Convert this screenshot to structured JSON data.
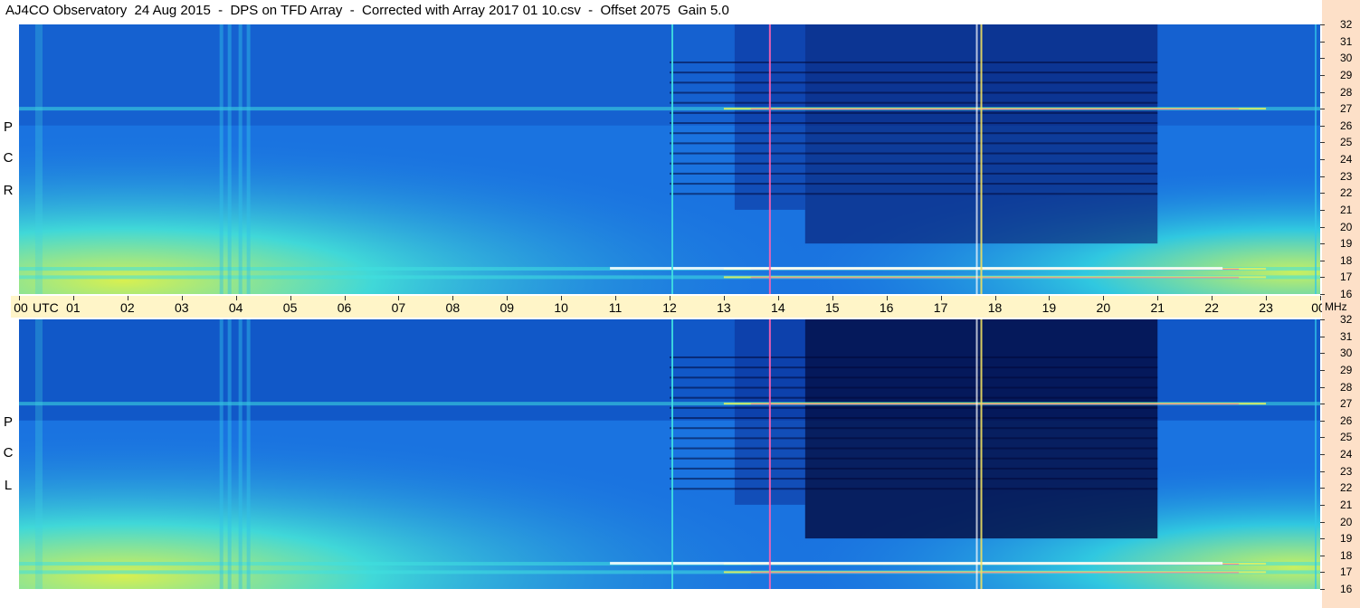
{
  "title": "AJ4CO Observatory  24 Aug 2015  -  DPS on TFD Array  -  Corrected with Array 2017 01 10.csv  -  Offset 2075  Gain 5.0",
  "panel_labels": {
    "top": [
      "R",
      "C",
      "P"
    ],
    "bottom": [
      "L",
      "C",
      "P"
    ]
  },
  "utc_axis_label": "UTC",
  "freq_unit": "MHz",
  "colors": {
    "background_blue": "#1a73e0",
    "dark_blue": "#081e7a",
    "cyan": "#2fd2e8",
    "yellow_green": "#c8f060",
    "utc_strip": "#fff5c8",
    "freq_column": "#fde0c8"
  },
  "chart_data": {
    "type": "heatmap",
    "title": "AJ4CO Observatory  24 Aug 2015  -  DPS on TFD Array  -  Corrected with Array 2017 01 10.csv  -  Offset 2075  Gain 5.0",
    "xlabel": "UTC",
    "ylabel": "MHz",
    "x_ticks": [
      "00",
      "01",
      "02",
      "03",
      "04",
      "05",
      "06",
      "07",
      "08",
      "09",
      "10",
      "11",
      "12",
      "13",
      "14",
      "15",
      "16",
      "17",
      "18",
      "19",
      "20",
      "21",
      "22",
      "23",
      "00"
    ],
    "xlim": [
      0,
      24
    ],
    "y_ticks": [
      "16",
      "17",
      "18",
      "19",
      "20",
      "21",
      "22",
      "23",
      "24",
      "25",
      "26",
      "27",
      "28",
      "29",
      "30",
      "31",
      "32"
    ],
    "ylim": [
      16,
      32
    ],
    "panels": [
      "RCP",
      "LCP"
    ],
    "features": [
      {
        "name": "broadband dark region",
        "x_range": [
          14.5,
          21
        ],
        "y_range": [
          16,
          32
        ]
      },
      {
        "name": "interference band",
        "y": 27
      },
      {
        "name": "interference band",
        "y": 17.5
      },
      {
        "name": "interference band",
        "y": 17
      },
      {
        "name": "vertical spike",
        "x": 12.05
      },
      {
        "name": "vertical spike",
        "x": 13.85
      },
      {
        "name": "vertical spike",
        "x": 17.75
      }
    ]
  }
}
